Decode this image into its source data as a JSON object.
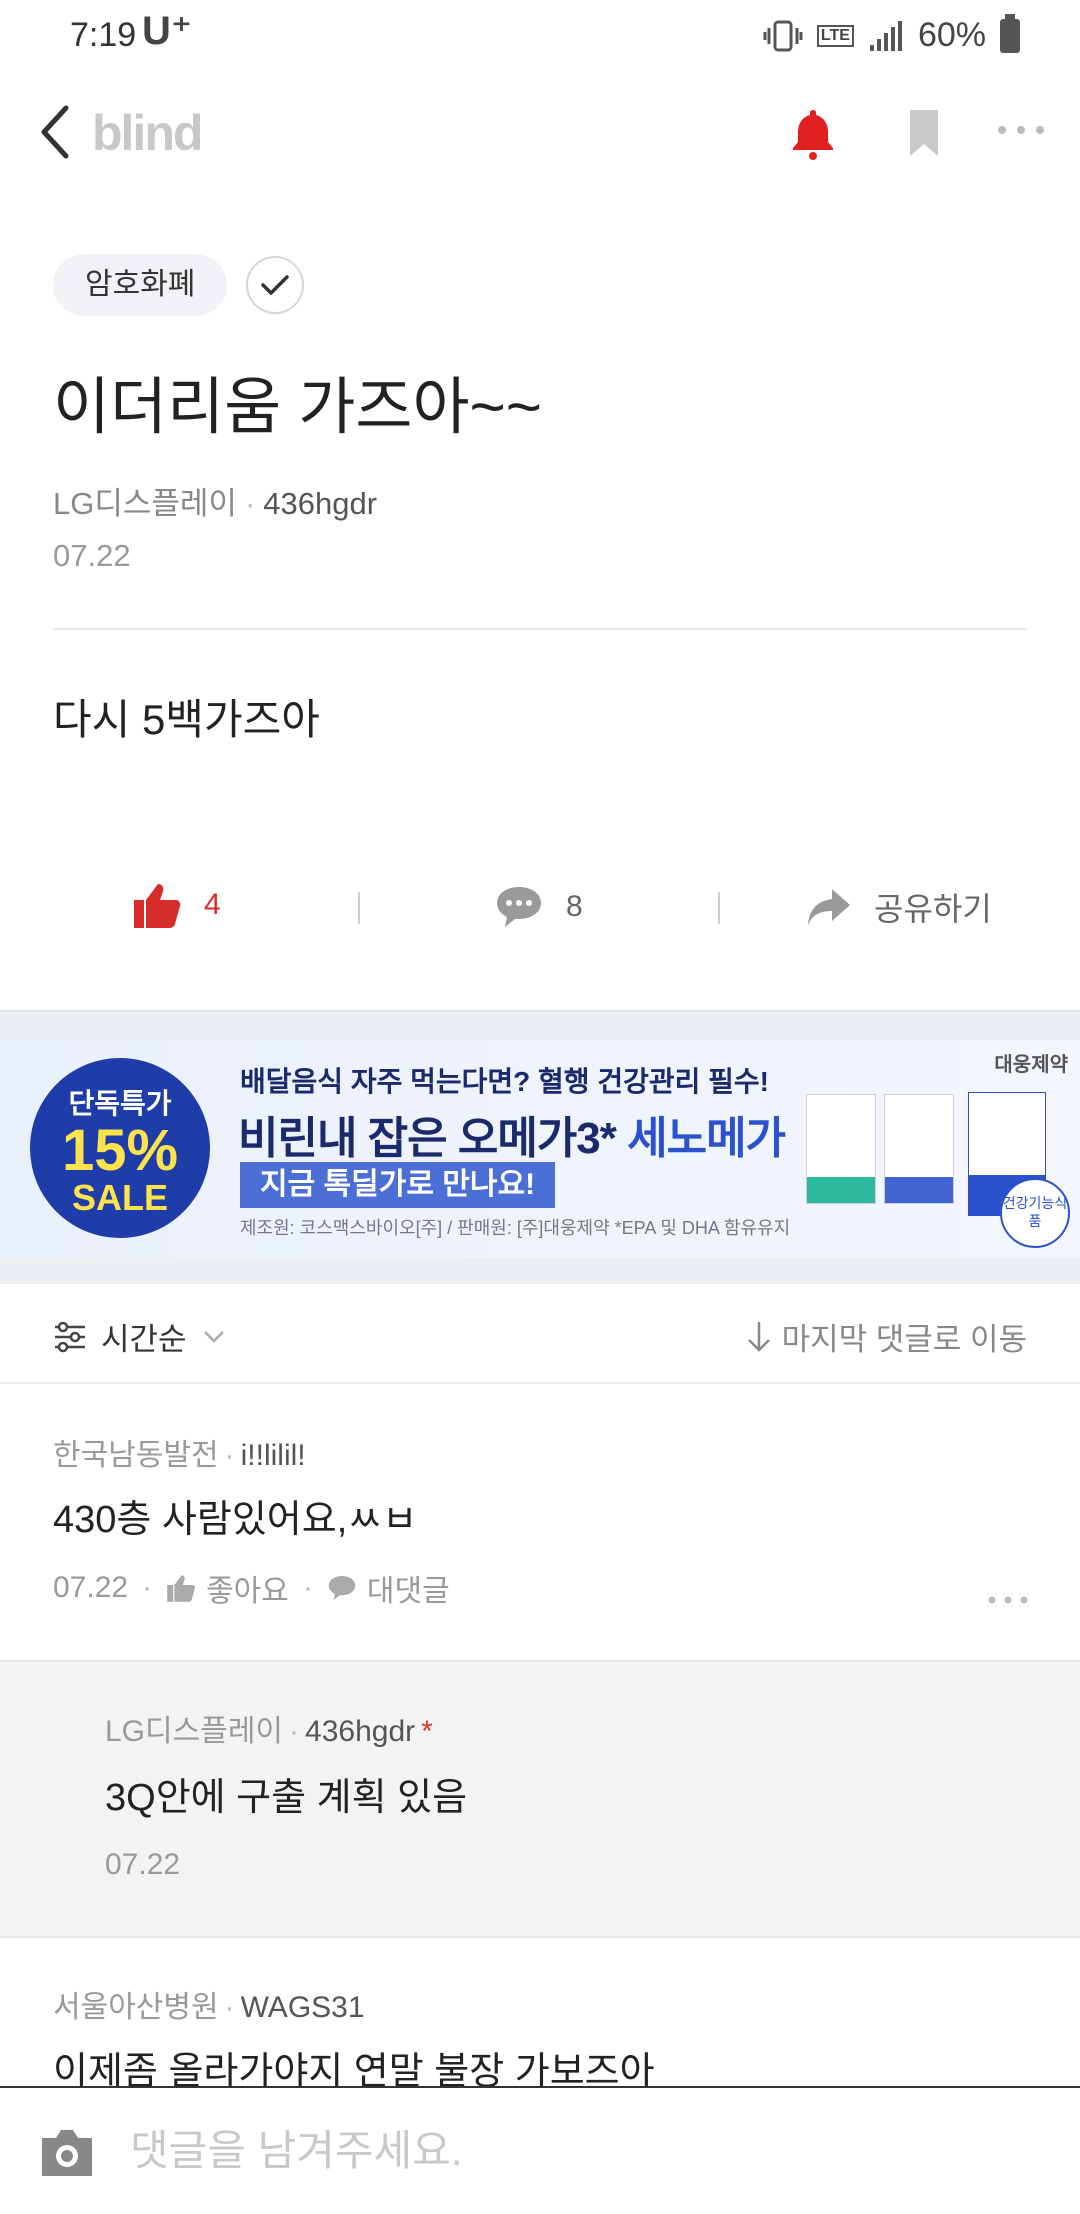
{
  "status_bar": {
    "time": "7:19",
    "carrier": "U⁺",
    "network": "LTE",
    "battery": "60%"
  },
  "app_bar": {
    "brand": "blind",
    "colors": {
      "bell": "#e02020",
      "brand": "#c8c8c8"
    },
    "icons": [
      "back-arrow-icon",
      "bell-icon",
      "bookmark-icon",
      "more-icon"
    ]
  },
  "post": {
    "topic": "암호화폐",
    "title": "이더리움 가즈아~~",
    "company": "LG디스플레이",
    "nickname": "436hgdr",
    "date": "07.22",
    "body": "다시 5백가즈아",
    "like_count": "4",
    "comment_count": "8",
    "share_label": "공유하기"
  },
  "ad": {
    "badge_line1": "단독특가",
    "badge_line2": "15%",
    "badge_line3": "SALE",
    "headline1": "배달음식 자주 먹는다면? 혈행 건강관리 필수!",
    "headline2_main": "비린내 잡은 오메가3* ",
    "headline2_accent": "세노메가",
    "cta": "지금 톡딜가로 만나요!",
    "fine_print": "제조원: 코스맥스바이오[주] / 판매원: [주]대웅제약  *EPA 및 DHA 함유유지",
    "brand": "대웅제약",
    "health_badge": "건강기능식품"
  },
  "sort": {
    "label": "시간순",
    "jump_label": "마지막 댓글로 이동"
  },
  "comments": [
    {
      "company": "한국남동발전",
      "nickname": "i!!lilil!",
      "text": "430층 사람있어요,ㅆㅂ",
      "date": "07.22",
      "like_label": "좋아요",
      "reply_label": "대댓글"
    },
    {
      "company": "LG디스플레이",
      "nickname": "436hgdr",
      "op_marker": "*",
      "text": "3Q안에 구출 계획 있음",
      "date": "07.22"
    },
    {
      "company": "서울아산병원",
      "nickname": "WAGS31",
      "text": "이제좀 올라가야지 연말 불장 가보즈아"
    }
  ],
  "input": {
    "placeholder": "댓글을 남겨주세요."
  }
}
